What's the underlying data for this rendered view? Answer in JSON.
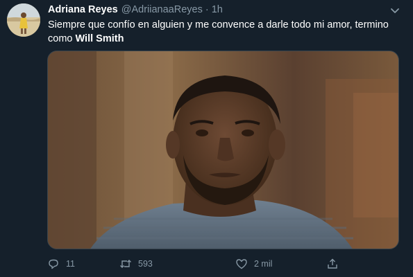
{
  "tweet": {
    "author_name": "Adriana Reyes",
    "handle": "@AdriianaaReyes",
    "separator": "·",
    "time": "1h",
    "text_part1": "Siempre que confío en alguien y me convence a darle todo mi amor, termino como ",
    "text_bold": "Will Smith",
    "media_icon": "photo-will-smith",
    "actions": {
      "reply": {
        "icon": "reply-icon",
        "count": "11"
      },
      "retweet": {
        "icon": "retweet-icon",
        "count": "593"
      },
      "like": {
        "icon": "heart-icon",
        "count": "2 mil"
      },
      "share": {
        "icon": "share-icon",
        "count": ""
      }
    }
  },
  "colors": {
    "background": "#15202b",
    "secondary_text": "#8899a6",
    "border": "#38444d"
  }
}
